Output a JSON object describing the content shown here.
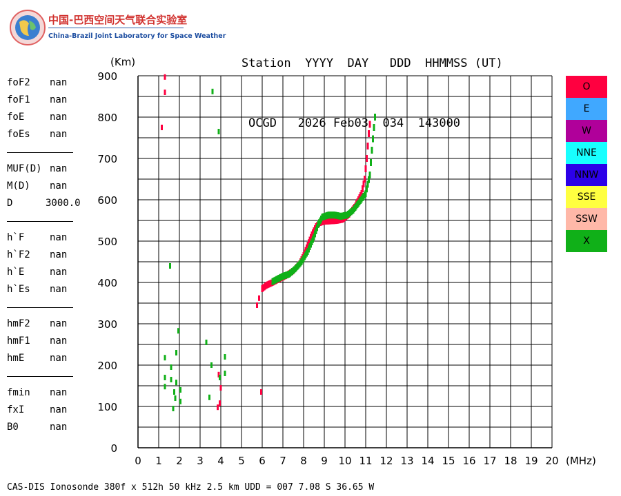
{
  "logo": {
    "cn": "中国-巴西空间天气联合实验室",
    "en": "China-Brazil Joint Laboratory for Space Weather"
  },
  "header": {
    "line1": "Station  YYYY  DAY   DDD  HHMMSS (UT)",
    "line2": "OCGD   2026 Feb03  034  143000"
  },
  "params": {
    "group1": [
      {
        "name": "foF2",
        "value": "nan"
      },
      {
        "name": "foF1",
        "value": "nan"
      },
      {
        "name": "foE",
        "value": "nan"
      },
      {
        "name": "foEs",
        "value": "nan"
      }
    ],
    "group2": [
      {
        "name": "MUF(D)",
        "value": "nan"
      },
      {
        "name": "M(D)",
        "value": "nan"
      },
      {
        "name": "D",
        "value": "3000.0"
      }
    ],
    "group3": [
      {
        "name": "h`F",
        "value": "nan"
      },
      {
        "name": "h`F2",
        "value": "nan"
      },
      {
        "name": "h`E",
        "value": "nan"
      },
      {
        "name": "h`Es",
        "value": "nan"
      }
    ],
    "group4": [
      {
        "name": "hmF2",
        "value": "nan"
      },
      {
        "name": "hmF1",
        "value": "nan"
      },
      {
        "name": "hmE",
        "value": "nan"
      }
    ],
    "group5": [
      {
        "name": "fmin",
        "value": "nan"
      },
      {
        "name": "fxI",
        "value": "nan"
      },
      {
        "name": "B0",
        "value": "nan"
      }
    ]
  },
  "legend": [
    {
      "label": "O",
      "color": "#ff0040"
    },
    {
      "label": "E",
      "color": "#40a8ff"
    },
    {
      "label": "W",
      "color": "#b0009a"
    },
    {
      "label": "NNE",
      "color": "#18ffff"
    },
    {
      "label": "NNW",
      "color": "#2c00e8"
    },
    {
      "label": "SSE",
      "color": "#ffff40"
    },
    {
      "label": "SSW",
      "color": "#ffb8a8"
    },
    {
      "label": "X",
      "color": "#10b018"
    }
  ],
  "footer": "CAS-DIS Ionosonde 380f x 512h 50 kHz 2.5 km UDD = 007 7.08 S 36.65 W",
  "chart_data": {
    "type": "scatter",
    "xlabel": "(MHz)",
    "ylabel": "(Km)",
    "xlim": [
      0,
      20
    ],
    "ylim": [
      0,
      900
    ],
    "xticks": [
      0,
      1,
      2,
      3,
      4,
      5,
      6,
      7,
      8,
      9,
      10,
      11,
      12,
      13,
      14,
      15,
      16,
      17,
      18,
      19,
      20
    ],
    "yticks": [
      0,
      100,
      200,
      300,
      400,
      500,
      600,
      700,
      800,
      900
    ],
    "grid": true,
    "series": [
      {
        "name": "O",
        "color": "#ff0040",
        "trace": [
          [
            6.0,
            385
          ],
          [
            6.2,
            393
          ],
          [
            6.5,
            400
          ],
          [
            6.8,
            408
          ],
          [
            7.0,
            413
          ],
          [
            7.2,
            418
          ],
          [
            7.5,
            428
          ],
          [
            7.8,
            445
          ],
          [
            8.0,
            465
          ],
          [
            8.2,
            490
          ],
          [
            8.4,
            515
          ],
          [
            8.6,
            535
          ],
          [
            8.8,
            545
          ],
          [
            9.0,
            548
          ],
          [
            9.3,
            549
          ],
          [
            9.6,
            550
          ],
          [
            9.9,
            553
          ],
          [
            10.2,
            565
          ],
          [
            10.5,
            585
          ],
          [
            10.8,
            615
          ],
          [
            10.95,
            650
          ],
          [
            11.05,
            700
          ],
          [
            11.15,
            760
          ],
          [
            11.25,
            805
          ]
        ],
        "points": [
          [
            1.3,
            897
          ],
          [
            1.3,
            860
          ],
          [
            1.15,
            775
          ],
          [
            5.75,
            345
          ],
          [
            5.85,
            362
          ],
          [
            5.95,
            135
          ],
          [
            3.9,
            177
          ],
          [
            3.95,
            108
          ],
          [
            3.85,
            98
          ],
          [
            4.0,
            145
          ]
        ]
      },
      {
        "name": "X",
        "color": "#10b018",
        "trace": [
          [
            6.5,
            402
          ],
          [
            6.8,
            410
          ],
          [
            7.0,
            415
          ],
          [
            7.3,
            420
          ],
          [
            7.6,
            433
          ],
          [
            7.9,
            450
          ],
          [
            8.2,
            475
          ],
          [
            8.5,
            510
          ],
          [
            8.7,
            540
          ],
          [
            8.9,
            558
          ],
          [
            9.2,
            563
          ],
          [
            9.5,
            563
          ],
          [
            9.8,
            560
          ],
          [
            10.1,
            563
          ],
          [
            10.4,
            575
          ],
          [
            10.7,
            595
          ],
          [
            11.0,
            615
          ],
          [
            11.2,
            660
          ],
          [
            11.3,
            720
          ],
          [
            11.4,
            775
          ],
          [
            11.5,
            825
          ]
        ],
        "points": [
          [
            3.6,
            862
          ],
          [
            3.9,
            765
          ],
          [
            1.55,
            440
          ],
          [
            1.95,
            283
          ],
          [
            3.3,
            255
          ],
          [
            1.3,
            218
          ],
          [
            1.85,
            230
          ],
          [
            3.55,
            200
          ],
          [
            4.2,
            220
          ],
          [
            4.2,
            180
          ],
          [
            1.3,
            170
          ],
          [
            1.3,
            148
          ],
          [
            1.6,
            165
          ],
          [
            1.6,
            195
          ],
          [
            1.85,
            158
          ],
          [
            1.75,
            135
          ],
          [
            2.05,
            140
          ],
          [
            1.8,
            120
          ],
          [
            2.05,
            112
          ],
          [
            1.7,
            95
          ],
          [
            3.45,
            122
          ],
          [
            3.95,
            170
          ]
        ]
      }
    ]
  }
}
